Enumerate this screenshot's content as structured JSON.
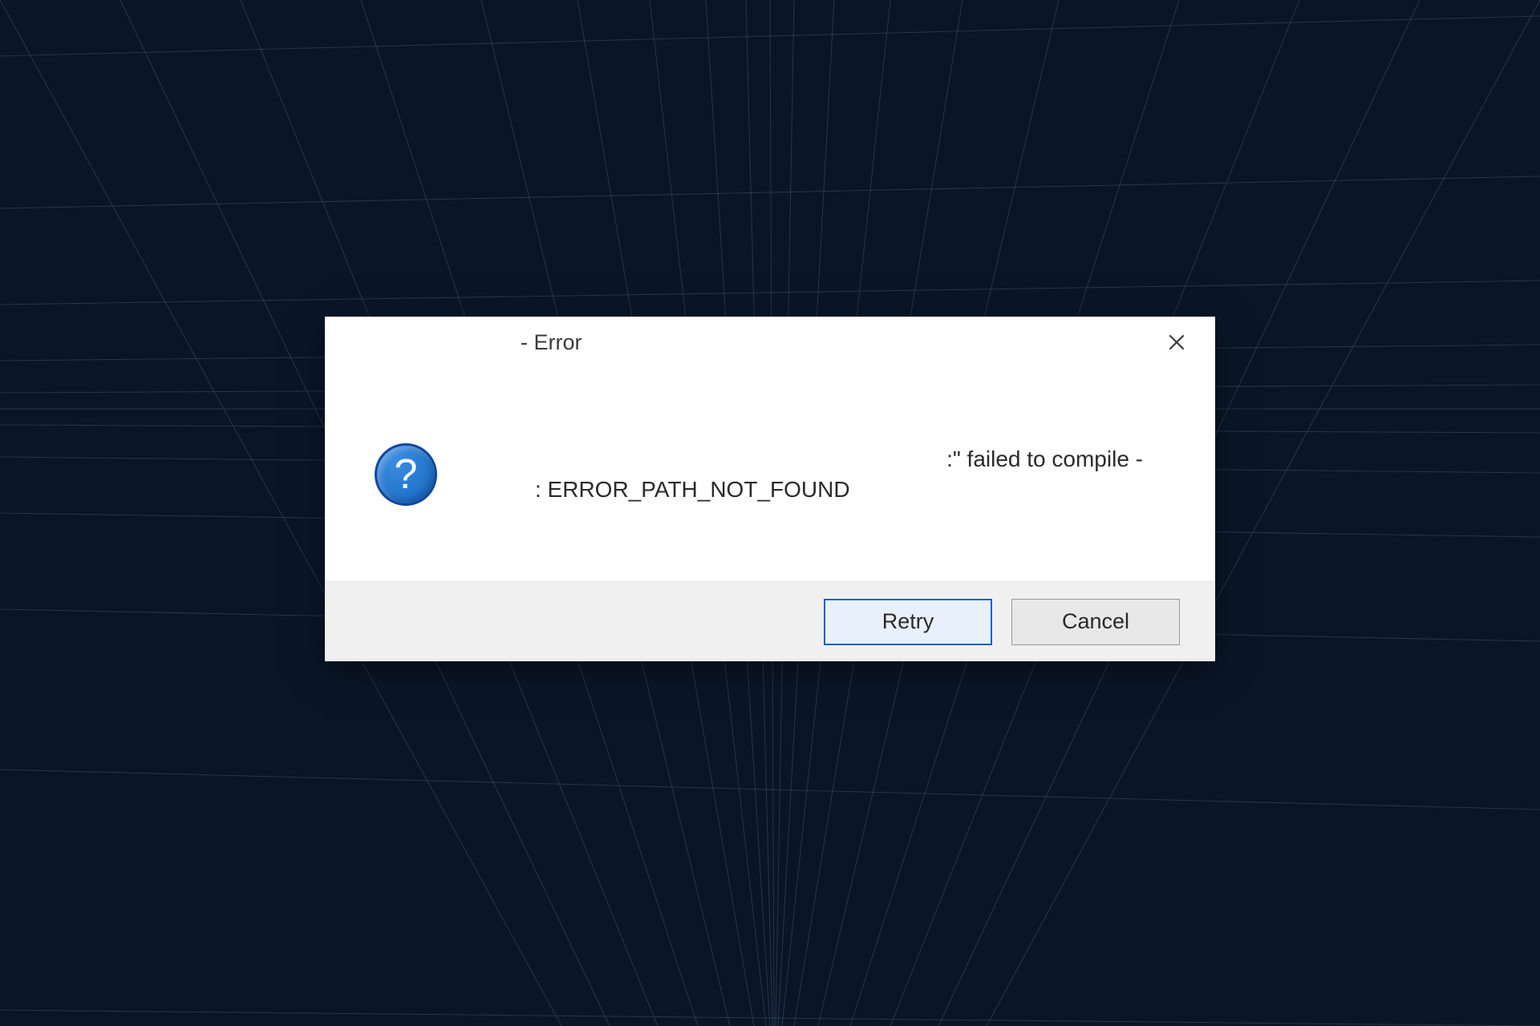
{
  "dialog": {
    "title": " - Error",
    "message_line1": ":\" failed to compile -",
    "message_line2": ": ERROR_PATH_NOT_FOUND",
    "icon": "question-icon",
    "buttons": {
      "retry_label": "Retry",
      "cancel_label": "Cancel"
    }
  }
}
